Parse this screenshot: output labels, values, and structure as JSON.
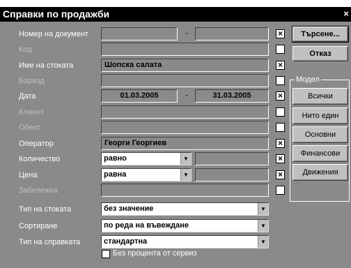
{
  "window": {
    "title": "Справки по продажби",
    "close_glyph": "×"
  },
  "fields": [
    {
      "label": "Номер на документ",
      "from": "",
      "to": "",
      "range": true,
      "checked": true,
      "dim": false
    },
    {
      "label": "Код",
      "value": "",
      "checked": false,
      "dim": true
    },
    {
      "label": "Име на стоката",
      "value": "Шопска салата",
      "checked": true,
      "dim": false
    },
    {
      "label": "Баркод",
      "value": "",
      "checked": false,
      "dim": true
    },
    {
      "label": "Дата",
      "from": "01.03.2005",
      "to": "31.03.2005",
      "range": true,
      "checked": true,
      "dim": false
    },
    {
      "label": "Клиент",
      "value": "",
      "checked": false,
      "dim": true
    },
    {
      "label": "Обект",
      "value": "",
      "checked": false,
      "dim": true
    },
    {
      "label": "Оператор",
      "value": "Георги Георгиев",
      "checked": true,
      "dim": false
    },
    {
      "label": "Количество",
      "select": "равно",
      "value": "",
      "checked": true,
      "dim": false
    },
    {
      "label": "Цена",
      "select": "равна",
      "value": "",
      "checked": true,
      "dim": false
    },
    {
      "label": "Забележка",
      "value": "",
      "checked": false,
      "dim": true
    }
  ],
  "range_separator": "-",
  "check_mark": "×",
  "dropdown_arrow": "▼",
  "dropdowns": [
    {
      "label": "Тип на стоката",
      "value": "без значение"
    },
    {
      "label": "Сортиране",
      "value": "по реда на въвеждане"
    },
    {
      "label": "Тип на справката",
      "value": "стандартна"
    }
  ],
  "buttons": {
    "search": "Търсене...",
    "cancel": "Отказ"
  },
  "model": {
    "label": "Модел",
    "buttons": [
      "Всички",
      "Нито един",
      "Основни",
      "Финансови",
      "Движения"
    ]
  },
  "bottom_option": {
    "label": "Без процента от сервиз",
    "checked": false
  }
}
